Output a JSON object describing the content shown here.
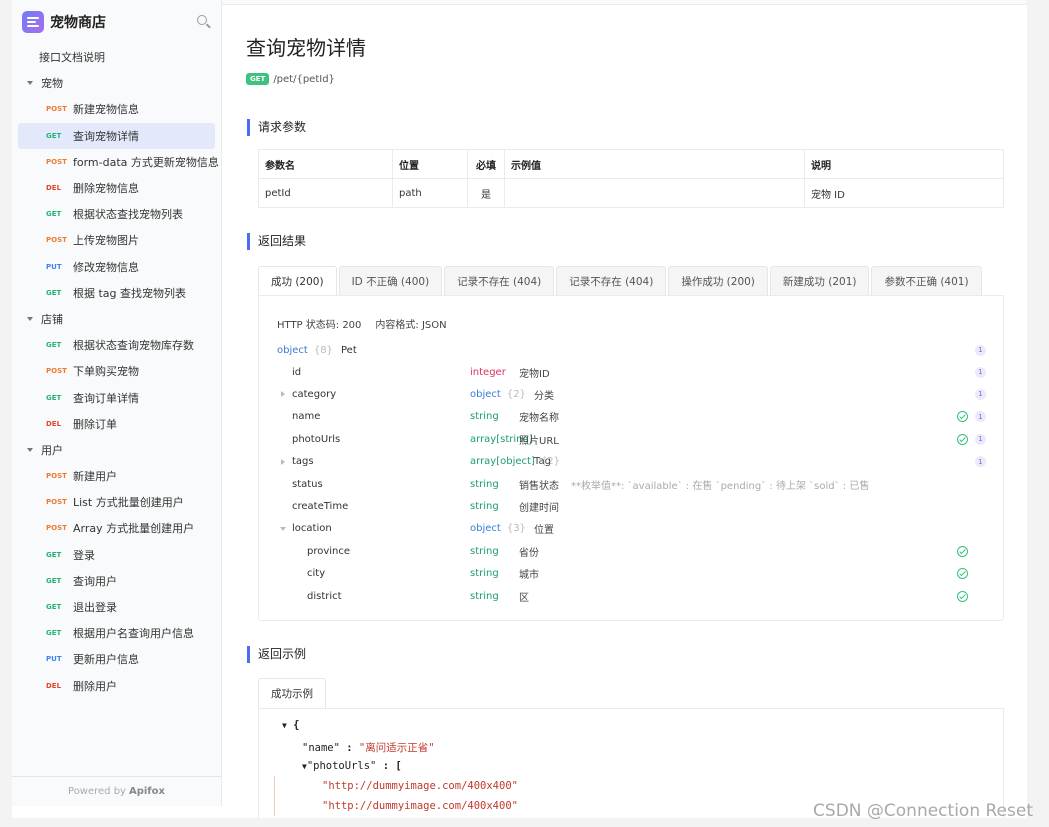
{
  "sidebar": {
    "brand": "宠物商店",
    "doc_link": "接口文档说明",
    "groups": [
      {
        "name": "宠物",
        "items": [
          {
            "method": "POST",
            "label": "新建宠物信息"
          },
          {
            "method": "GET",
            "label": "查询宠物详情",
            "active": true
          },
          {
            "method": "POST",
            "label": "form-data 方式更新宠物信息"
          },
          {
            "method": "DEL",
            "label": "删除宠物信息"
          },
          {
            "method": "GET",
            "label": "根据状态查找宠物列表"
          },
          {
            "method": "POST",
            "label": "上传宠物图片"
          },
          {
            "method": "PUT",
            "label": "修改宠物信息"
          },
          {
            "method": "GET",
            "label": "根据 tag 查找宠物列表"
          }
        ]
      },
      {
        "name": "店铺",
        "items": [
          {
            "method": "GET",
            "label": "根据状态查询宠物库存数"
          },
          {
            "method": "POST",
            "label": "下单购买宠物"
          },
          {
            "method": "GET",
            "label": "查询订单详情"
          },
          {
            "method": "DEL",
            "label": "删除订单"
          }
        ]
      },
      {
        "name": "用户",
        "items": [
          {
            "method": "POST",
            "label": "新建用户"
          },
          {
            "method": "POST",
            "label": "List 方式批量创建用户"
          },
          {
            "method": "POST",
            "label": "Array 方式批量创建用户"
          },
          {
            "method": "GET",
            "label": "登录"
          },
          {
            "method": "GET",
            "label": "查询用户"
          },
          {
            "method": "GET",
            "label": "退出登录"
          },
          {
            "method": "GET",
            "label": "根据用户名查询用户信息"
          },
          {
            "method": "PUT",
            "label": "更新用户信息"
          },
          {
            "method": "DEL",
            "label": "删除用户"
          }
        ]
      }
    ],
    "powered_prefix": "Powered by",
    "powered_brand": "Apifox"
  },
  "main": {
    "title": "查询宠物详情",
    "method": "GET",
    "path": "/pet/{petId}",
    "params_title": "请求参数",
    "params_headers": [
      "参数名",
      "位置",
      "必填",
      "示例值",
      "说明"
    ],
    "params_rows": [
      [
        "petId",
        "path",
        "是",
        "",
        "宠物 ID"
      ]
    ],
    "result_title": "返回结果",
    "tabs": [
      "成功 (200)",
      "ID 不正确 (400)",
      "记录不存在 (404)",
      "记录不存在 (404)",
      "操作成功 (200)",
      "新建成功 (201)",
      "参数不正确 (401)"
    ],
    "http_status": "HTTP 状态码: 200",
    "content_type": "内容格式: JSON",
    "schema_root": {
      "type": "object",
      "count": "{8}",
      "name": "Pet",
      "ver": "1"
    },
    "schema_rows": [
      {
        "name": "id",
        "type": "integer",
        "desc": "宠物ID",
        "ver": "1"
      },
      {
        "name": "category",
        "type": "object",
        "count": "{2}",
        "desc": "分类",
        "ver": "1"
      },
      {
        "name": "name",
        "type": "string",
        "desc": "宠物名称",
        "ver": "1"
      },
      {
        "name": "photoUrls",
        "type": "array[string]",
        "desc": "照片URL",
        "ver": "1"
      },
      {
        "name": "tags",
        "type": "array[object]",
        "count": "{2}",
        "desc": "Tag",
        "ver": "1"
      },
      {
        "name": "status",
        "type": "string",
        "desc": "销售状态",
        "note": "**枚举值**: `available` : 在售 `pending` : 待上架 `sold` : 已售"
      },
      {
        "name": "createTime",
        "type": "string",
        "desc": "创建时间"
      },
      {
        "name": "location",
        "type": "object",
        "count": "{3}",
        "desc": "位置"
      },
      {
        "name": "province",
        "type": "string",
        "desc": "省份"
      },
      {
        "name": "city",
        "type": "string",
        "desc": "城市"
      },
      {
        "name": "district",
        "type": "string",
        "desc": "区"
      }
    ],
    "example_title": "返回示例",
    "example_tab": "成功示例",
    "code": {
      "open": "{",
      "name_key": "\"name\"",
      "name_val": "\"离问适示正省\"",
      "photo_key": "\"photoUrls\"",
      "bracket": "[",
      "url1": "\"http://dummyimage.com/400x400\"",
      "url2": "\"http://dummyimage.com/400x400\""
    }
  },
  "watermark": "CSDN @Connection Reset"
}
